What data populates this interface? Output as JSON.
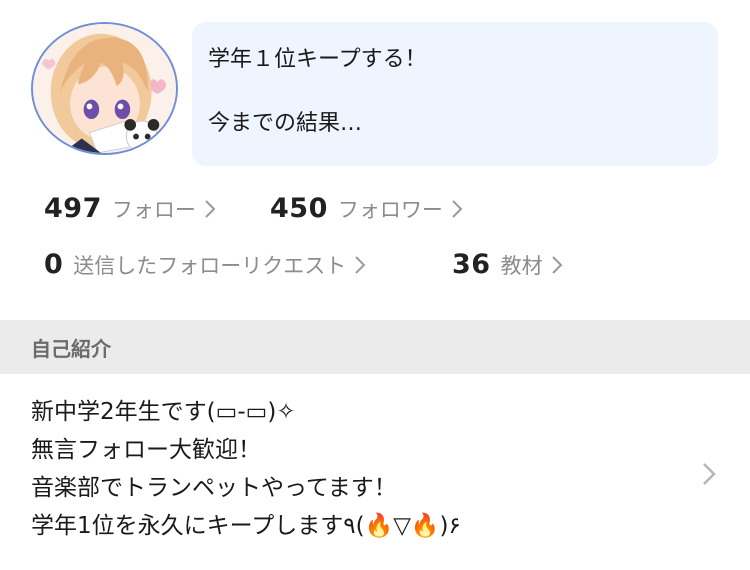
{
  "status": {
    "line1": "学年１位キープする！",
    "line2": "今までの結果…"
  },
  "stats": {
    "following": {
      "count": "497",
      "label": "フォロー"
    },
    "followers": {
      "count": "450",
      "label": "フォロワー"
    },
    "requests": {
      "count": "0",
      "label": "送信したフォローリクエスト"
    },
    "materials": {
      "count": "36",
      "label": "教材"
    }
  },
  "section": {
    "title": "自己紹介"
  },
  "bio": {
    "lines": [
      "新中学2年生です(▭-▭)✧",
      "無言フォロー大歓迎！",
      "音楽部でトランペットやってます！",
      "学年1位を永久にキープします٩(🔥▽🔥)۶"
    ]
  },
  "icons": {
    "chevron": "chevron-right-icon",
    "avatar": "avatar-illustration"
  },
  "colors": {
    "bubble_bg": "#eef5ff",
    "section_bg": "#ebebeb",
    "label_gray": "#8c8c8c",
    "avatar_border": "#6f8fd6"
  }
}
